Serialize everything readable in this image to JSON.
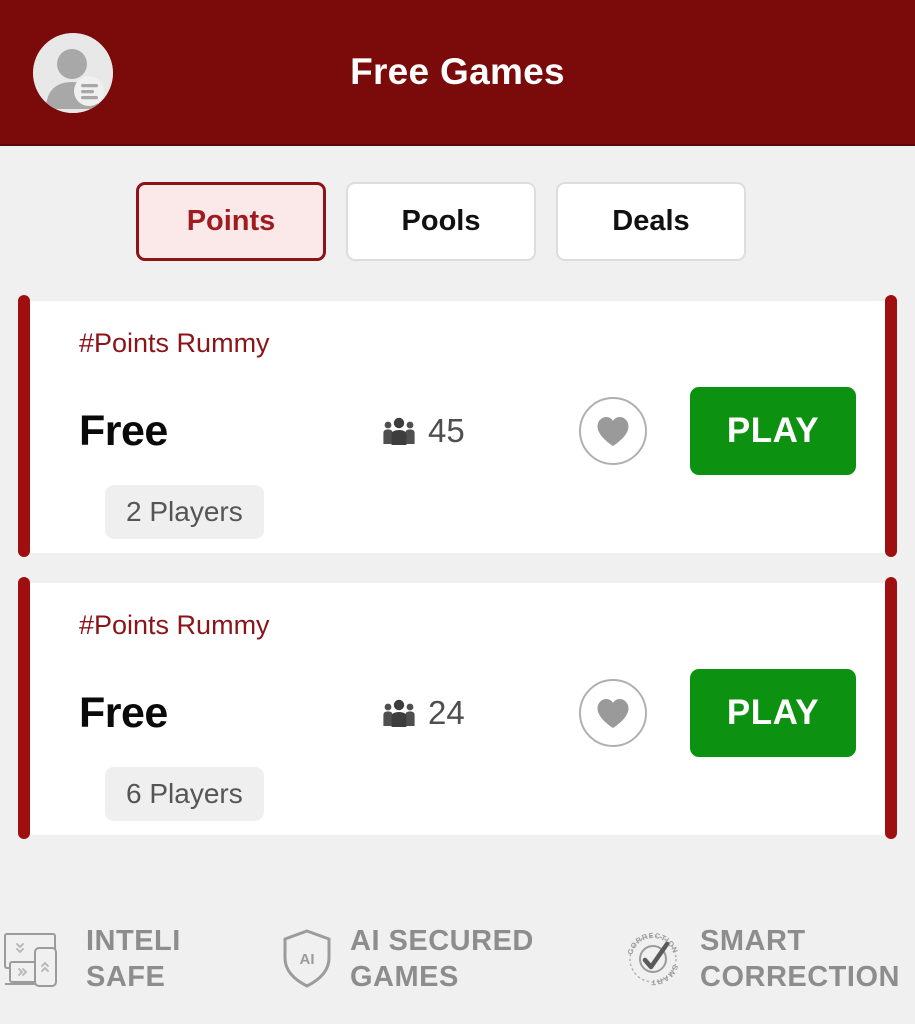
{
  "header": {
    "title": "Free Games",
    "avatar_icon": "user-avatar-icon",
    "background_color": "#7b0a0a"
  },
  "tabs": [
    {
      "label": "Points",
      "active": true
    },
    {
      "label": "Pools",
      "active": false
    },
    {
      "label": "Deals",
      "active": false
    }
  ],
  "cards": [
    {
      "tag": "#Points Rummy",
      "price": "Free",
      "players_online": "45",
      "players_icon": "group-of-people-icon",
      "favorite_icon": "heart-icon",
      "play_label": "PLAY",
      "seats": "2 Players"
    },
    {
      "tag": "#Points Rummy",
      "price": "Free",
      "players_online": "24",
      "players_icon": "group-of-people-icon",
      "favorite_icon": "heart-icon",
      "play_label": "PLAY",
      "seats": "6 Players"
    }
  ],
  "footer": {
    "badges": [
      {
        "icon": "devices-icon",
        "text": "INTELI\nSAFE"
      },
      {
        "icon": "shield-ai-icon",
        "text": "AI SECURED\nGAMES"
      },
      {
        "icon": "smart-correction-icon",
        "text": "SMART\nCORRECTION"
      }
    ]
  },
  "colors": {
    "brand_red": "#7b0a0a",
    "accent_red": "#a00f10",
    "tag_red": "#8b1418",
    "play_green": "#0c9110",
    "page_bg": "#f0f0f0"
  }
}
